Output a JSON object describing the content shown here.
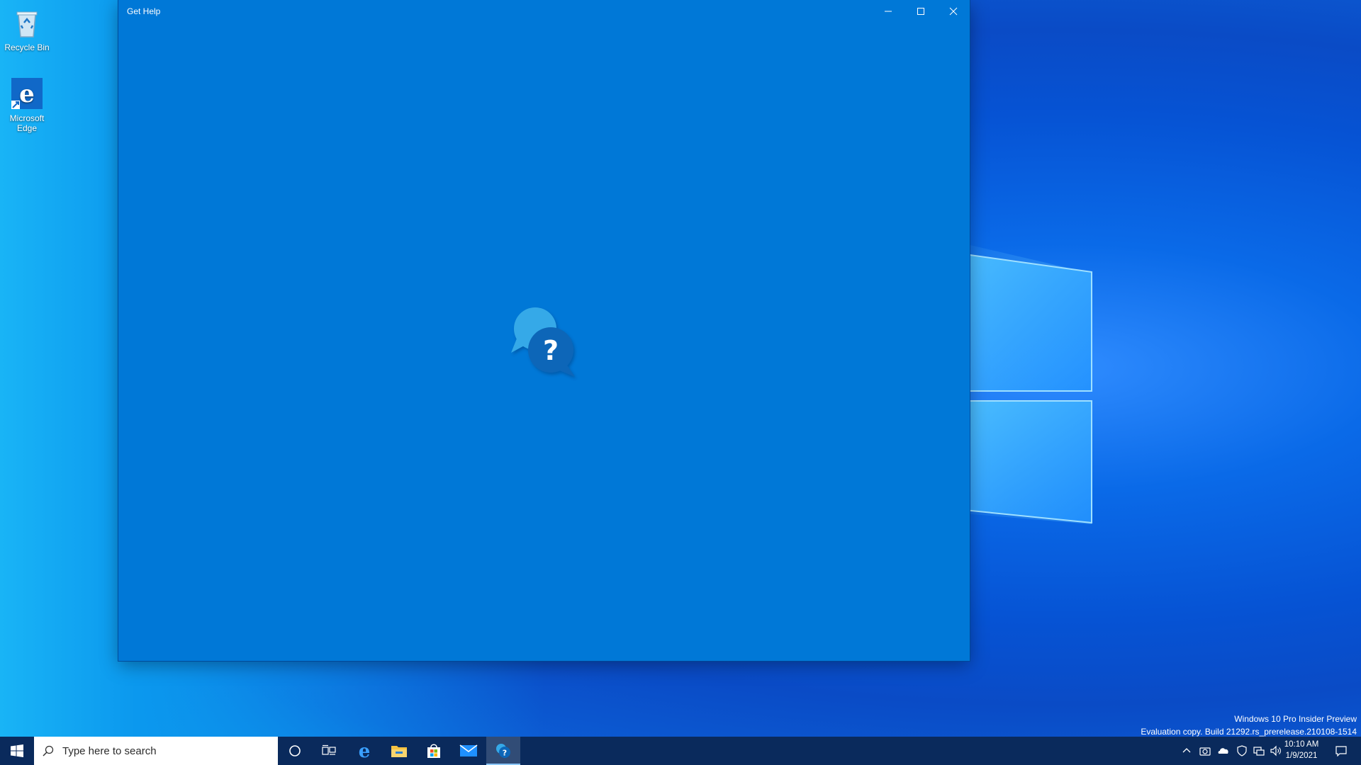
{
  "desktop": {
    "icons": [
      {
        "label": "Recycle Bin",
        "icon": "recycle-bin-icon"
      },
      {
        "label": "Microsoft Edge",
        "icon": "edge-icon"
      }
    ]
  },
  "window": {
    "title": "Get Help",
    "splash_icon": "get-help-icon",
    "background": "#0078d7",
    "controls": [
      "minimize-icon",
      "maximize-icon",
      "close-icon"
    ]
  },
  "watermark": {
    "line1": "Windows 10 Pro Insider Preview",
    "line2": "Evaluation copy. Build 21292.rs_prerelease.210108-1514"
  },
  "taskbar": {
    "search_placeholder": "Type here to search",
    "apps": [
      "start-icon",
      "cortana-icon",
      "task-view-icon",
      "edge-icon",
      "file-explorer-icon",
      "store-icon",
      "mail-icon",
      "get-help-icon"
    ],
    "clock_time": "10:10 AM",
    "clock_date": "1/9/2021",
    "tray_icons": [
      "chevron-up-icon",
      "camera-icon",
      "onedrive-icon",
      "security-icon",
      "network-icon",
      "volume-icon",
      "notification-icon"
    ],
    "color": "#0a2a5c"
  }
}
